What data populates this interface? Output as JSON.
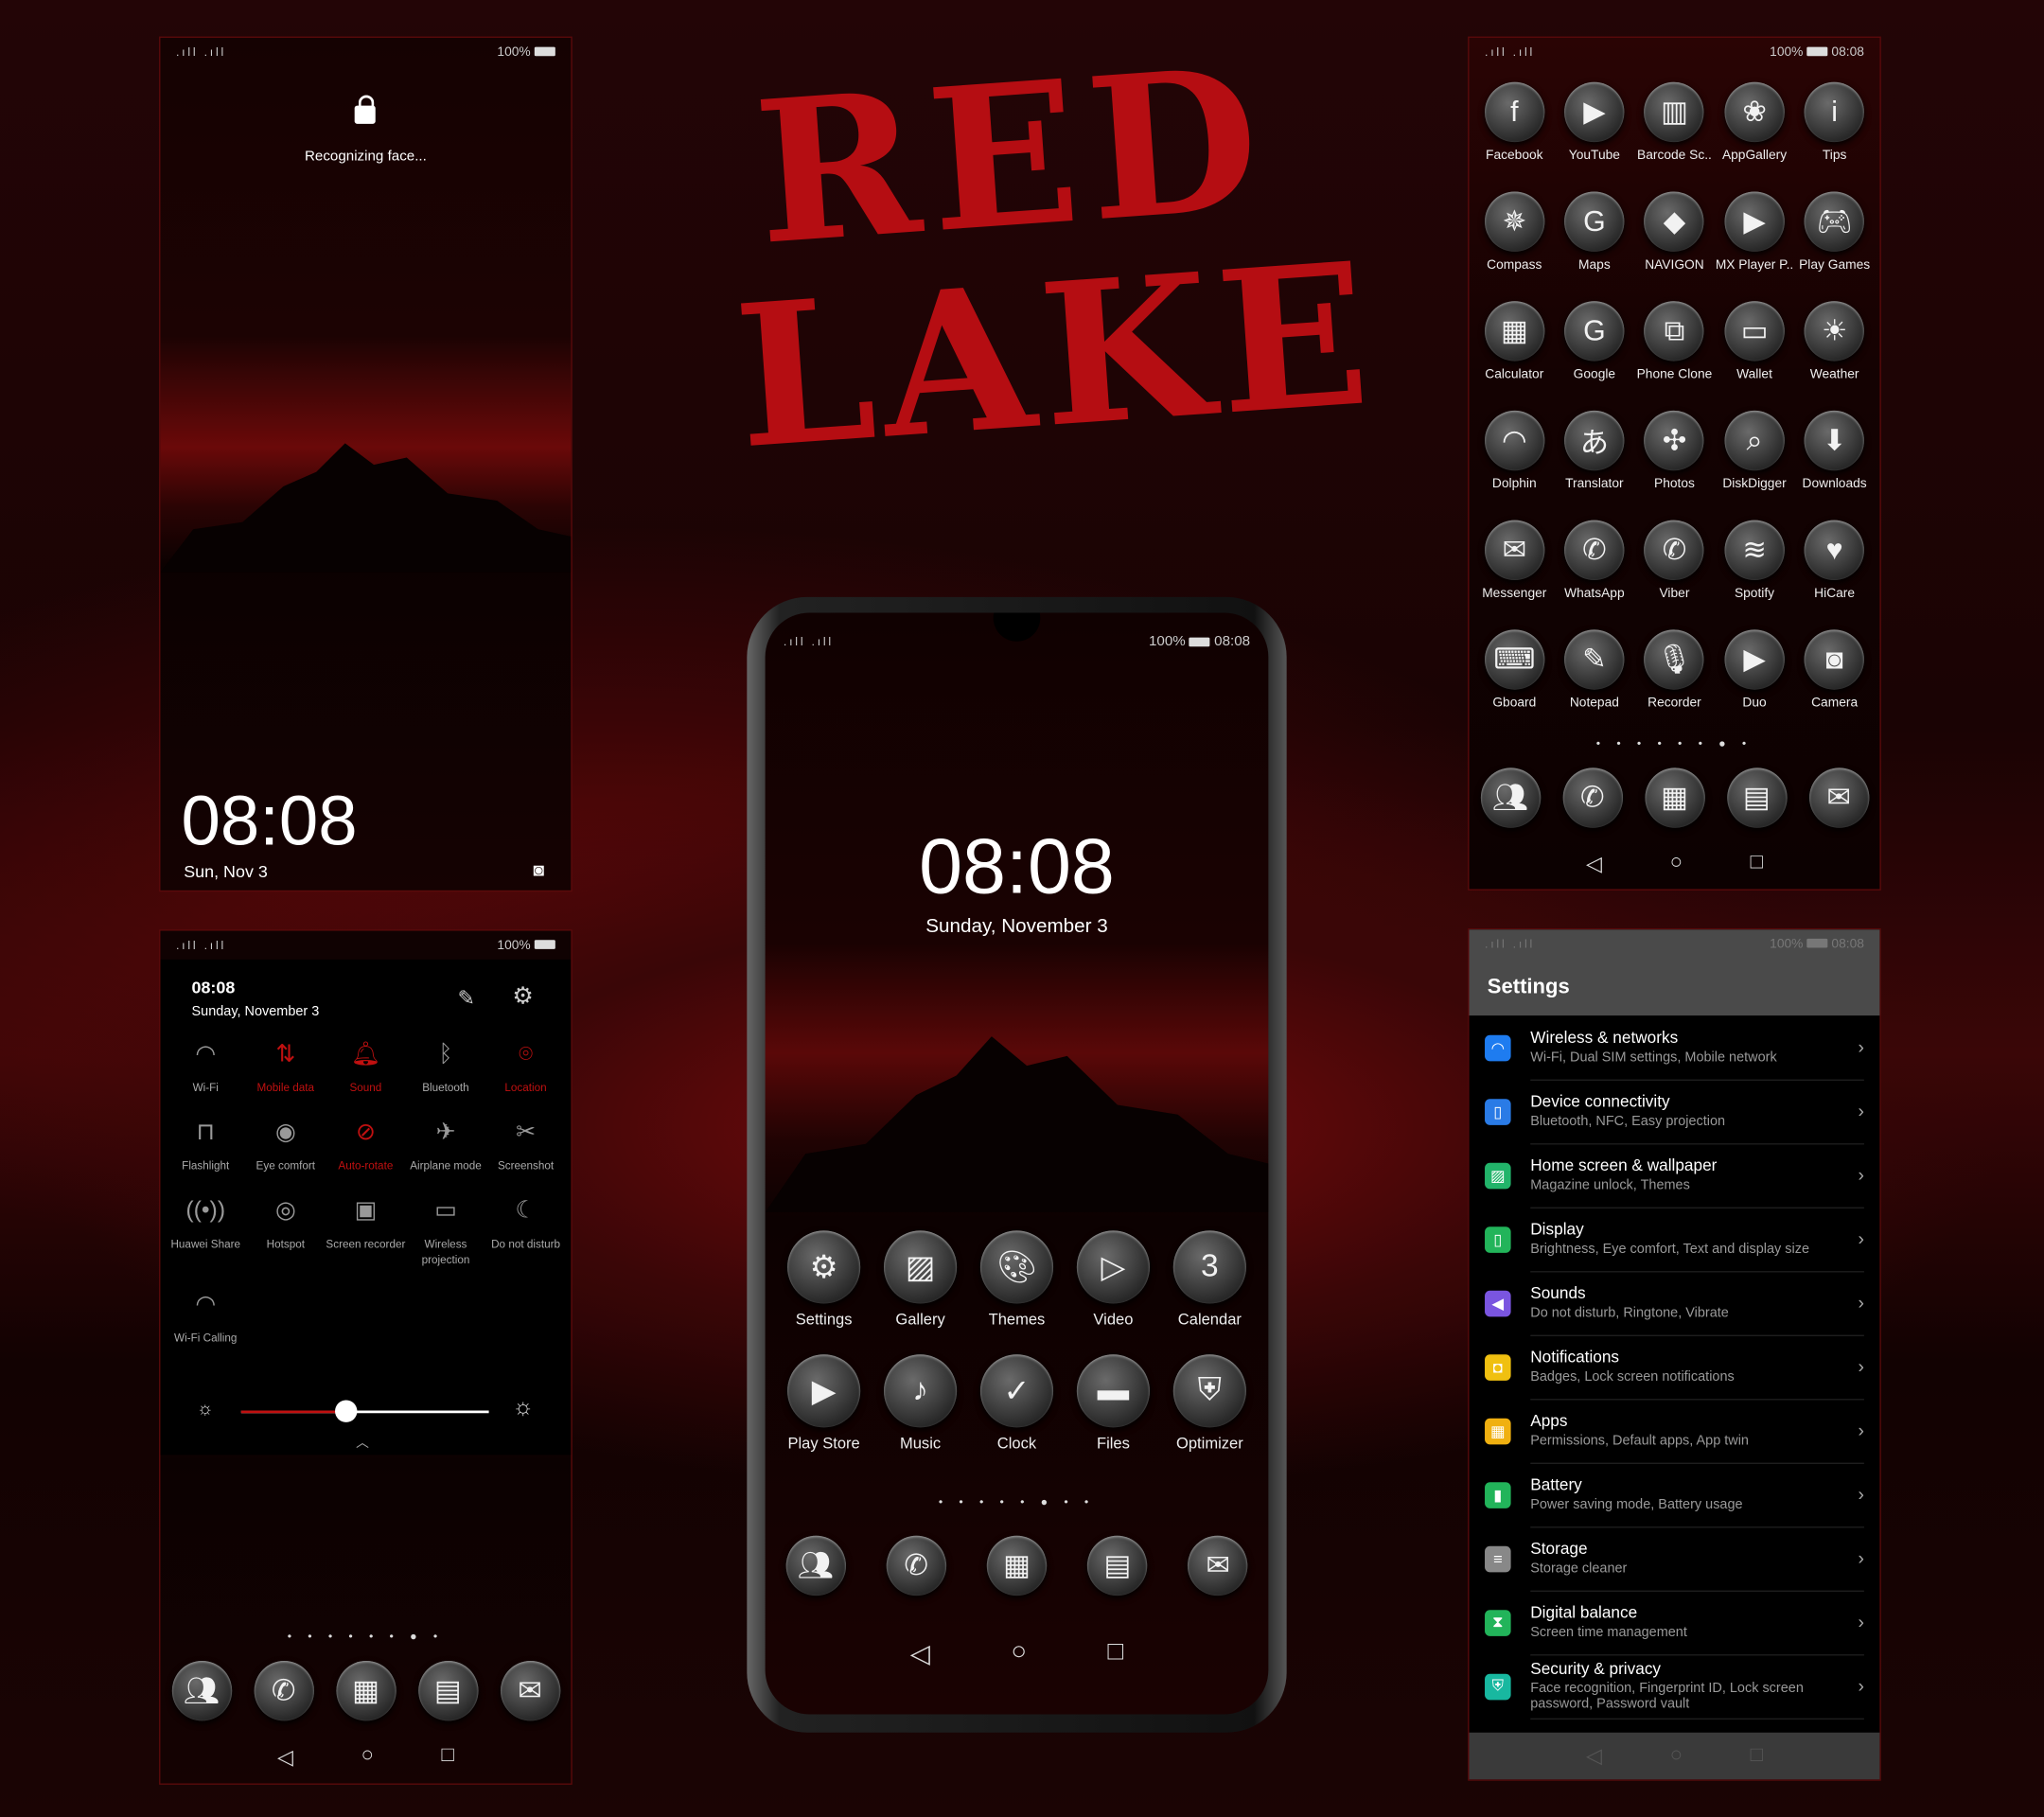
{
  "title_art": {
    "text_line1": "RED",
    "text_line2": "LAKE",
    "color": "#b50d12"
  },
  "status": {
    "battery": "100%",
    "time": "08:08",
    "signal": ".ıll .ıll"
  },
  "lock_screen": {
    "prompt": "Recognizing face...",
    "lock_icon": "lock-icon",
    "time": "08:08",
    "date": "Sun, Nov 3",
    "camera_icon": "camera-icon"
  },
  "quick_settings": {
    "time": "08:08",
    "date": "Sunday, November 3",
    "tiles": [
      {
        "label": "Wi-Fi",
        "icon": "wifi-icon",
        "glyph": "◠",
        "on": false
      },
      {
        "label": "Mobile data",
        "icon": "mobile-data-icon",
        "glyph": "⇅",
        "on": true
      },
      {
        "label": "Sound",
        "icon": "bell-icon",
        "glyph": "🔔︎",
        "on": true
      },
      {
        "label": "Bluetooth",
        "icon": "bluetooth-icon",
        "glyph": "ᛒ",
        "on": false
      },
      {
        "label": "Location",
        "icon": "location-icon",
        "glyph": "⌾",
        "on": true
      },
      {
        "label": "Flashlight",
        "icon": "flashlight-icon",
        "glyph": "⊓",
        "on": false
      },
      {
        "label": "Eye comfort",
        "icon": "eye-icon",
        "glyph": "◉",
        "on": false
      },
      {
        "label": "Auto-rotate",
        "icon": "rotate-icon",
        "glyph": "⊘",
        "on": true
      },
      {
        "label": "Airplane mode",
        "icon": "airplane-icon",
        "glyph": "✈",
        "on": false
      },
      {
        "label": "Screenshot",
        "icon": "screenshot-icon",
        "glyph": "✂",
        "on": false
      },
      {
        "label": "Huawei Share",
        "icon": "share-icon",
        "glyph": "((•))",
        "on": false
      },
      {
        "label": "Hotspot",
        "icon": "hotspot-icon",
        "glyph": "◎",
        "on": false
      },
      {
        "label": "Screen recorder",
        "icon": "recorder-icon",
        "glyph": "▣",
        "on": false
      },
      {
        "label": "Wireless projection",
        "icon": "projection-icon",
        "glyph": "▭",
        "on": false
      },
      {
        "label": "Do not disturb",
        "icon": "moon-icon",
        "glyph": "☾",
        "on": false
      },
      {
        "label": "Wi-Fi Calling",
        "icon": "wifi-calling-icon",
        "glyph": "◠",
        "on": false
      }
    ],
    "brightness": 0.42,
    "accent": "#c01010"
  },
  "home": {
    "time": "08:08",
    "date": "Sunday, November 3",
    "apps": [
      {
        "label": "Settings",
        "glyph": "⚙"
      },
      {
        "label": "Gallery",
        "glyph": "▨"
      },
      {
        "label": "Themes",
        "glyph": "🎨︎"
      },
      {
        "label": "Video",
        "glyph": "▷"
      },
      {
        "label": "Calendar",
        "glyph": "3"
      },
      {
        "label": "Play Store",
        "glyph": "▶"
      },
      {
        "label": "Music",
        "glyph": "♪"
      },
      {
        "label": "Clock",
        "glyph": "✓"
      },
      {
        "label": "Files",
        "glyph": "▬"
      },
      {
        "label": "Optimizer",
        "glyph": "⛨"
      }
    ],
    "page_dots": "• • • • • ● • •"
  },
  "dock": [
    {
      "name": "contacts",
      "glyph": "👥︎"
    },
    {
      "name": "phone",
      "glyph": "✆"
    },
    {
      "name": "apps",
      "glyph": "▦"
    },
    {
      "name": "messages",
      "glyph": "▤"
    },
    {
      "name": "email",
      "glyph": "✉"
    }
  ],
  "drawer": {
    "apps": [
      {
        "label": "Facebook",
        "glyph": "f"
      },
      {
        "label": "YouTube",
        "glyph": "▶"
      },
      {
        "label": "Barcode Sc..",
        "glyph": "▥"
      },
      {
        "label": "AppGallery",
        "glyph": "❀"
      },
      {
        "label": "Tips",
        "glyph": "i"
      },
      {
        "label": "Compass",
        "glyph": "✵"
      },
      {
        "label": "Maps",
        "glyph": "G"
      },
      {
        "label": "NAVIGON",
        "glyph": "◆"
      },
      {
        "label": "MX Player P..",
        "glyph": "▶"
      },
      {
        "label": "Play Games",
        "glyph": "🎮︎"
      },
      {
        "label": "Calculator",
        "glyph": "▦"
      },
      {
        "label": "Google",
        "glyph": "G"
      },
      {
        "label": "Phone Clone",
        "glyph": "⧉"
      },
      {
        "label": "Wallet",
        "glyph": "▭"
      },
      {
        "label": "Weather",
        "glyph": "☀"
      },
      {
        "label": "Dolphin",
        "glyph": "◠"
      },
      {
        "label": "Translator",
        "glyph": "あ"
      },
      {
        "label": "Photos",
        "glyph": "✣"
      },
      {
        "label": "DiskDigger",
        "glyph": "⌕"
      },
      {
        "label": "Downloads",
        "glyph": "⬇"
      },
      {
        "label": "Messenger",
        "glyph": "✉"
      },
      {
        "label": "WhatsApp",
        "glyph": "✆"
      },
      {
        "label": "Viber",
        "glyph": "✆"
      },
      {
        "label": "Spotify",
        "glyph": "≋"
      },
      {
        "label": "HiCare",
        "glyph": "♥"
      },
      {
        "label": "Gboard",
        "glyph": "⌨"
      },
      {
        "label": "Notepad",
        "glyph": "✎"
      },
      {
        "label": "Recorder",
        "glyph": "🎙︎"
      },
      {
        "label": "Duo",
        "glyph": "▶"
      },
      {
        "label": "Camera",
        "glyph": "◙"
      }
    ],
    "page_dots": "• • • • • • ● •"
  },
  "settings": {
    "title": "Settings",
    "items": [
      {
        "title": "Wireless & networks",
        "sub": "Wi-Fi, Dual SIM settings, Mobile network",
        "color": "#1e7cf0",
        "glyph": "◠"
      },
      {
        "title": "Device connectivity",
        "sub": "Bluetooth, NFC, Easy projection",
        "color": "#2a7be6",
        "glyph": "▯"
      },
      {
        "title": "Home screen & wallpaper",
        "sub": "Magazine unlock, Themes",
        "color": "#22b46a",
        "glyph": "▨"
      },
      {
        "title": "Display",
        "sub": "Brightness, Eye comfort, Text and display size",
        "color": "#22b45a",
        "glyph": "▯"
      },
      {
        "title": "Sounds",
        "sub": "Do not disturb, Ringtone, Vibrate",
        "color": "#7a55e0",
        "glyph": "◀"
      },
      {
        "title": "Notifications",
        "sub": "Badges, Lock screen notifications",
        "color": "#f0c010",
        "glyph": "◘"
      },
      {
        "title": "Apps",
        "sub": "Permissions, Default apps, App twin",
        "color": "#f0b010",
        "glyph": "▦"
      },
      {
        "title": "Battery",
        "sub": "Power saving mode, Battery usage",
        "color": "#22b45a",
        "glyph": "▮"
      },
      {
        "title": "Storage",
        "sub": "Storage cleaner",
        "color": "#888888",
        "glyph": "≡"
      },
      {
        "title": "Digital balance",
        "sub": "Screen time management",
        "color": "#22b45a",
        "glyph": "⧗"
      },
      {
        "title": "Security & privacy",
        "sub": "Face recognition, Fingerprint ID, Lock screen password, Password vault",
        "color": "#18b8a0",
        "glyph": "⛨"
      }
    ]
  },
  "nav": {
    "back": "◁",
    "home": "○",
    "recents": "□"
  }
}
